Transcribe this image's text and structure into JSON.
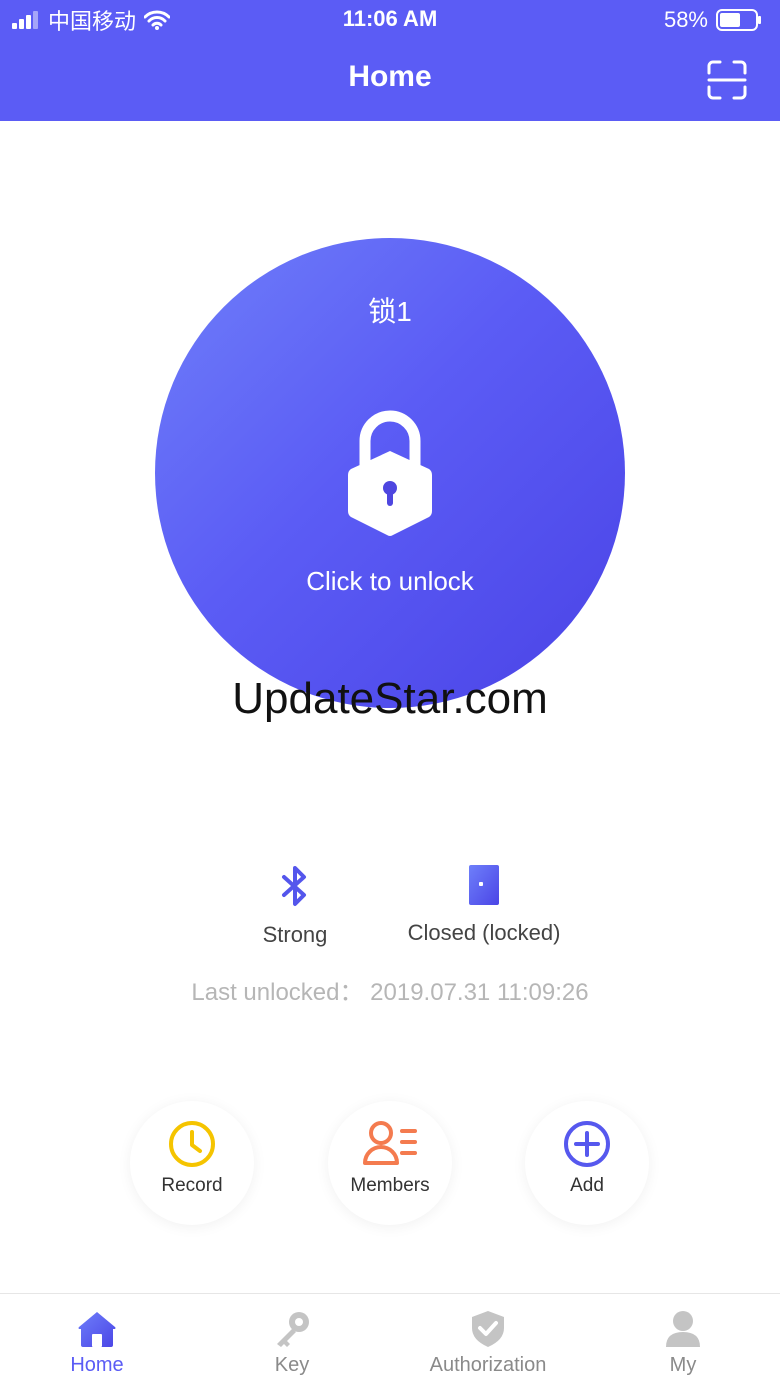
{
  "status_bar": {
    "carrier": "中国移动",
    "time": "11:06 AM",
    "battery_percent": "58%",
    "battery_level": 0.58
  },
  "header": {
    "title": "Home"
  },
  "lock": {
    "name": "锁1",
    "action_text": "Click to unlock"
  },
  "watermark": "UpdateStar.com",
  "lock_status": {
    "signal": "Strong",
    "door": "Closed (locked)",
    "last_unlocked": "Last unlocked：  2019.07.31 11:09:26"
  },
  "actions": [
    {
      "label": "Record",
      "icon": "clock-icon"
    },
    {
      "label": "Members",
      "icon": "members-icon"
    },
    {
      "label": "Add",
      "icon": "plus-circle-icon"
    }
  ],
  "tabs": [
    {
      "label": "Home",
      "icon": "home-icon",
      "active": true
    },
    {
      "label": "Key",
      "icon": "key-icon",
      "active": false
    },
    {
      "label": "Authorization",
      "icon": "shield-check-icon",
      "active": false
    },
    {
      "label": "My",
      "icon": "person-icon",
      "active": false
    }
  ],
  "colors": {
    "primary": "#5b5cf5",
    "record": "#f5c400",
    "members": "#f47b4f",
    "add": "#5658ee",
    "inactive": "#c4c4c4"
  }
}
